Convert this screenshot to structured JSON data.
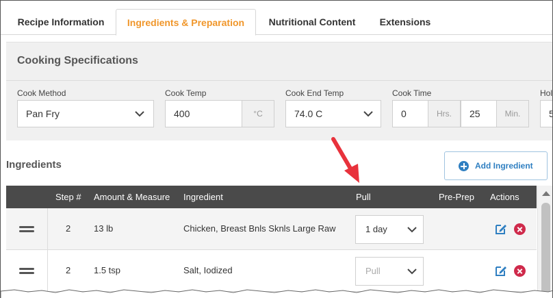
{
  "tabs": [
    {
      "label": "Recipe Information",
      "active": false
    },
    {
      "label": "Ingredients & Preparation",
      "active": true
    },
    {
      "label": "Nutritional Content",
      "active": false
    },
    {
      "label": "Extensions",
      "active": false
    }
  ],
  "cooking_specs": {
    "title": "Cooking Specifications",
    "cook_method": {
      "label": "Cook Method",
      "value": "Pan Fry"
    },
    "cook_temp": {
      "label": "Cook Temp",
      "value": "400",
      "unit": "°C"
    },
    "cook_end_temp": {
      "label": "Cook End Temp",
      "value": "74.0 C"
    },
    "cook_time": {
      "label": "Cook Time",
      "hours": "0",
      "hours_unit": "Hrs.",
      "minutes": "25",
      "minutes_unit": "Min."
    },
    "hold": {
      "label": "Hol",
      "value": "5"
    }
  },
  "ingredients": {
    "title": "Ingredients",
    "add_button": "Add Ingredient",
    "columns": {
      "step": "Step #",
      "amount": "Amount & Measure",
      "ingredient": "Ingredient",
      "pull": "Pull",
      "preprep": "Pre-Prep",
      "actions": "Actions"
    },
    "rows": [
      {
        "step": "2",
        "amount": "13 lb",
        "ingredient": "Chicken, Breast Bnls Sknls Large Raw",
        "pull": "1 day"
      },
      {
        "step": "2",
        "amount": "1.5 tsp",
        "ingredient": "Salt, Iodized",
        "pull_placeholder": "Pull"
      }
    ]
  },
  "colors": {
    "accent_tab": "#f0962a",
    "header_bg": "#4a4a4a",
    "primary_blue": "#2f7fc1",
    "delete_red": "#cf2a4b",
    "annotation_arrow": "#e8323c"
  },
  "icons": {
    "chevron": "chevron-down-icon",
    "drag": "drag-handle-icon",
    "edit": "edit-icon",
    "delete": "delete-icon",
    "add": "plus-circle-icon"
  }
}
